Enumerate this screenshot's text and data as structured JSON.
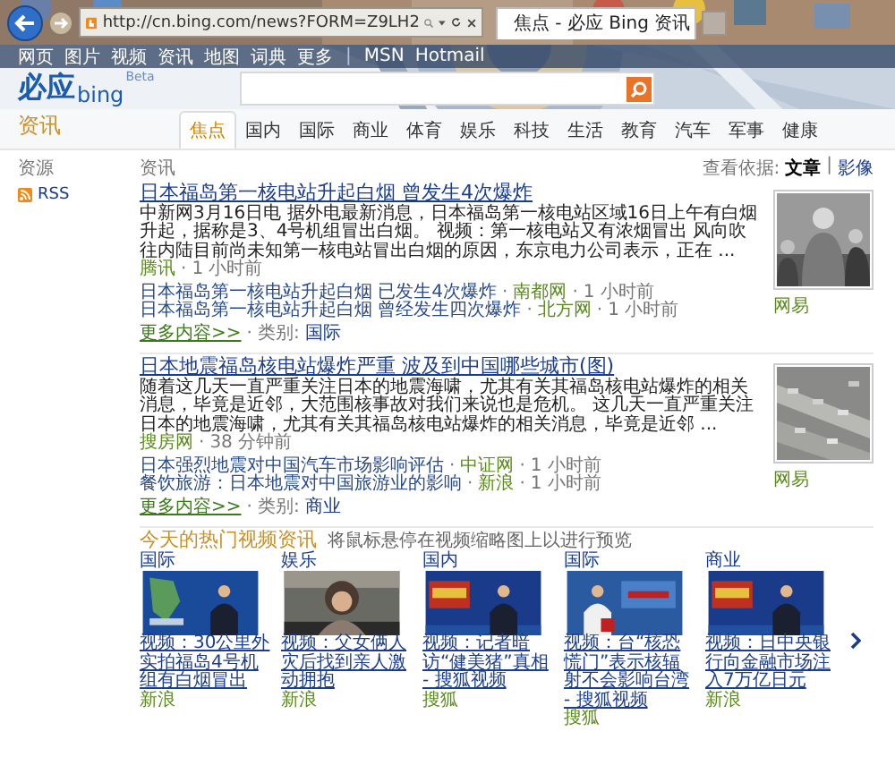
{
  "browser": {
    "url": "http://cn.bing.com/news?FORM=Z9LH2",
    "tab_title": "焦点 - 必应 Bing 资讯"
  },
  "top_nav": [
    {
      "label": "网页",
      "kind": "link"
    },
    {
      "label": "图片",
      "kind": "link"
    },
    {
      "label": "视频",
      "kind": "link"
    },
    {
      "label": "资讯",
      "kind": "link"
    },
    {
      "label": "地图",
      "kind": "link"
    },
    {
      "label": "词典",
      "kind": "link"
    },
    {
      "label": "更多",
      "kind": "link"
    },
    {
      "label": "|",
      "kind": "separator"
    },
    {
      "label": "MSN",
      "kind": "link"
    },
    {
      "label": "Hotmail",
      "kind": "link"
    }
  ],
  "logo": {
    "name": "必应",
    "brand": "bing",
    "badge": "Beta"
  },
  "section_title": "资讯",
  "categories": [
    {
      "label": "焦点",
      "selected": true
    },
    {
      "label": "国内",
      "selected": false
    },
    {
      "label": "国际",
      "selected": false
    },
    {
      "label": "商业",
      "selected": false
    },
    {
      "label": "体育",
      "selected": false
    },
    {
      "label": "娱乐",
      "selected": false
    },
    {
      "label": "科技",
      "selected": false
    },
    {
      "label": "生活",
      "selected": false
    },
    {
      "label": "教育",
      "selected": false
    },
    {
      "label": "汽车",
      "selected": false
    },
    {
      "label": "军事",
      "selected": false
    },
    {
      "label": "健康",
      "selected": false
    }
  ],
  "sidebar": {
    "heading": "资源",
    "items": [
      "RSS"
    ]
  },
  "main_heading": "资讯",
  "view_by": {
    "label": "查看依据:",
    "separator": "|",
    "options": [
      {
        "label": "文章",
        "selected": true
      },
      {
        "label": "影像",
        "selected": false
      }
    ]
  },
  "separator": "·",
  "articles": [
    {
      "title": "日本福岛第一核电站升起白烟 曾发生4次爆炸",
      "summary": "中新网3月16日电 据外电最新消息，日本福岛第一核电站区域16日上午有白烟升起，据称是3、4号机组冒出白烟。 视频：第一核电站又有浓烟冒出 风向吹往内陆目前尚未知第一核电站冒出白烟的原因，东京电力公司表示，正在 ...",
      "source": "腾讯",
      "time": "1 小时前",
      "related": [
        {
          "title": "日本福岛第一核电站升起白烟 已发生4次爆炸",
          "source": "南都网",
          "time": "1 小时前"
        },
        {
          "title": "日本福岛第一核电站升起白烟 曾经发生四次爆炸",
          "source": "北方网",
          "time": "1 小时前"
        }
      ],
      "more": "更多内容>>",
      "category_label": "类别:",
      "category": "国际",
      "image_source": "网易"
    },
    {
      "title": "日本地震福岛核电站爆炸严重 波及到中国哪些城市(图)",
      "summary": "随着这几天一直严重关注日本的地震海啸，尤其有关其福岛核电站爆炸的相关消息，毕竟是近邻，大范围核事故对我们来说也是危机。 这几天一直严重关注日本的地震海啸，尤其有关其福岛核电站爆炸的相关消息，毕竟是近邻 ...",
      "source": "搜房网",
      "time": "38 分钟前",
      "related": [
        {
          "title": "日本强烈地震对中国汽车市场影响评估",
          "source": "中证网",
          "time": "1 小时前"
        },
        {
          "title": "餐饮旅游：日本地震对中国旅游业的影响",
          "source": "新浪",
          "time": "1 小时前"
        }
      ],
      "more": "更多内容>>",
      "category_label": "类别:",
      "category": "商业",
      "image_source": "网易"
    }
  ],
  "videos": {
    "title": "今天的热门视频资讯",
    "hint": "将鼠标悬停在视频缩略图上以进行预览",
    "items": [
      {
        "category": "国际",
        "title": "视频：30公里外实拍福岛4号机组有白烟冒出",
        "source": "新浪"
      },
      {
        "category": "娱乐",
        "title": "视频：父女俩人灾后找到亲人激动拥抱",
        "source": "新浪"
      },
      {
        "category": "国内",
        "title": "视频：记者暗访“健美猪”真相 - 搜狐视频",
        "source": "搜狐"
      },
      {
        "category": "国际",
        "title": "视频：台“核恐慌门”表示核辐射不会影响台湾 - 搜狐视频",
        "source": "搜狐"
      },
      {
        "category": "商业",
        "title": "视频：日中央银行向金融市场注入7万亿日元",
        "source": "新浪"
      }
    ]
  }
}
